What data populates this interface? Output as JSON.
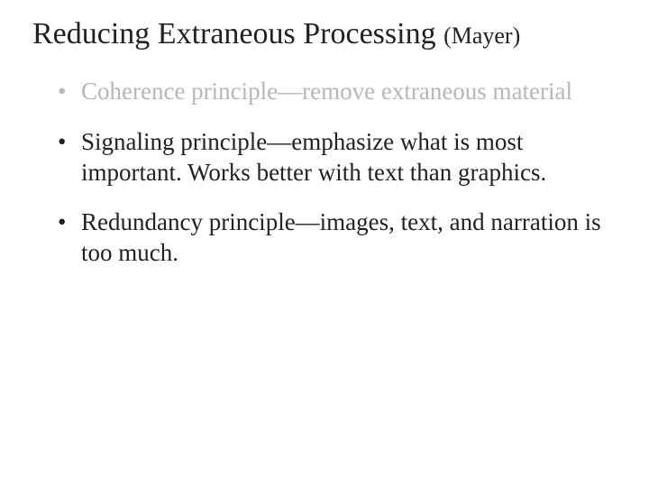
{
  "title": {
    "main": "Reducing Extraneous Processing",
    "attribution": "(Mayer)"
  },
  "bullets": [
    {
      "text": "Coherence principle—remove extraneous material",
      "dimmed": true
    },
    {
      "text": "Signaling principle—emphasize what is most important. Works better with text than graphics.",
      "dimmed": false
    },
    {
      "text": "Redundancy principle—images, text, and narration is too much.",
      "dimmed": false
    }
  ]
}
